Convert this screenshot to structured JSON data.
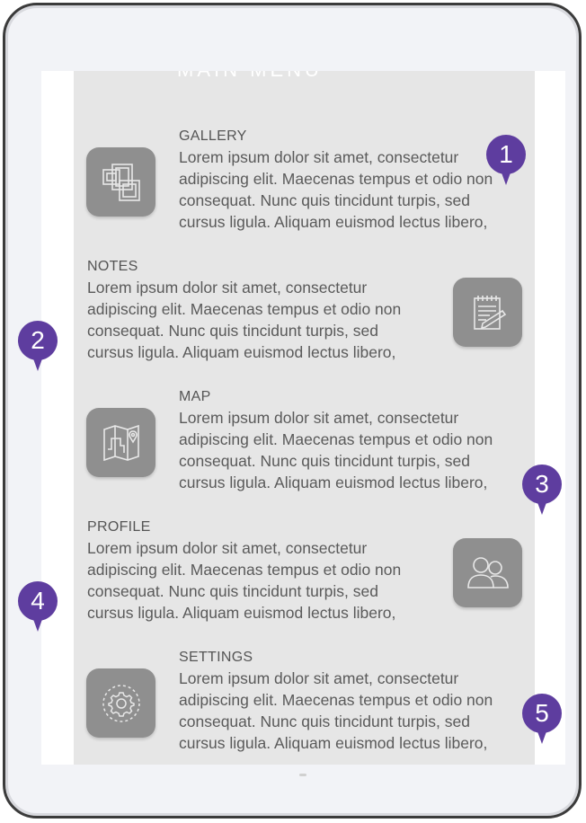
{
  "header": {
    "faded_title": "MAIN MENU"
  },
  "menu": [
    {
      "title": "GALLERY",
      "icon": "gallery-icon",
      "lines": [
        "Lorem ipsum dolor sit amet, consectetur",
        "adipiscing elit. Maecenas tempus et odio non",
        "consequat. Nunc quis tincidunt turpis, sed",
        "cursus ligula. Aliquam euismod lectus libero,"
      ]
    },
    {
      "title": "NOTES",
      "icon": "notes-icon",
      "lines": [
        "Lorem ipsum dolor sit amet, consectetur",
        "adipiscing elit. Maecenas tempus et odio non",
        "consequat. Nunc quis tincidunt turpis, sed",
        "cursus ligula. Aliquam euismod lectus libero,"
      ]
    },
    {
      "title": "MAP",
      "icon": "map-icon",
      "lines": [
        "Lorem ipsum dolor sit amet, consectetur",
        "adipiscing elit. Maecenas tempus et odio non",
        "consequat. Nunc quis tincidunt turpis, sed",
        "cursus ligula. Aliquam euismod lectus libero,"
      ]
    },
    {
      "title": "PROFILE",
      "icon": "profile-icon",
      "lines": [
        "Lorem ipsum dolor sit amet, consectetur",
        "adipiscing elit. Maecenas tempus et odio non",
        "consequat. Nunc quis tincidunt turpis, sed",
        "cursus ligula. Aliquam euismod lectus libero,"
      ]
    },
    {
      "title": "SETTINGS",
      "icon": "settings-icon",
      "lines": [
        "Lorem ipsum dolor sit amet, consectetur",
        "adipiscing elit. Maecenas tempus et odio non",
        "consequat. Nunc quis tincidunt turpis, sed",
        "cursus ligula. Aliquam euismod lectus libero,"
      ]
    }
  ],
  "markers": [
    "1",
    "2",
    "3",
    "4",
    "5"
  ],
  "colors": {
    "marker": "#5e3d9f",
    "icon_tile": "#8f8f8f",
    "panel": "#e6e6e6",
    "text": "#5a5a5a"
  }
}
